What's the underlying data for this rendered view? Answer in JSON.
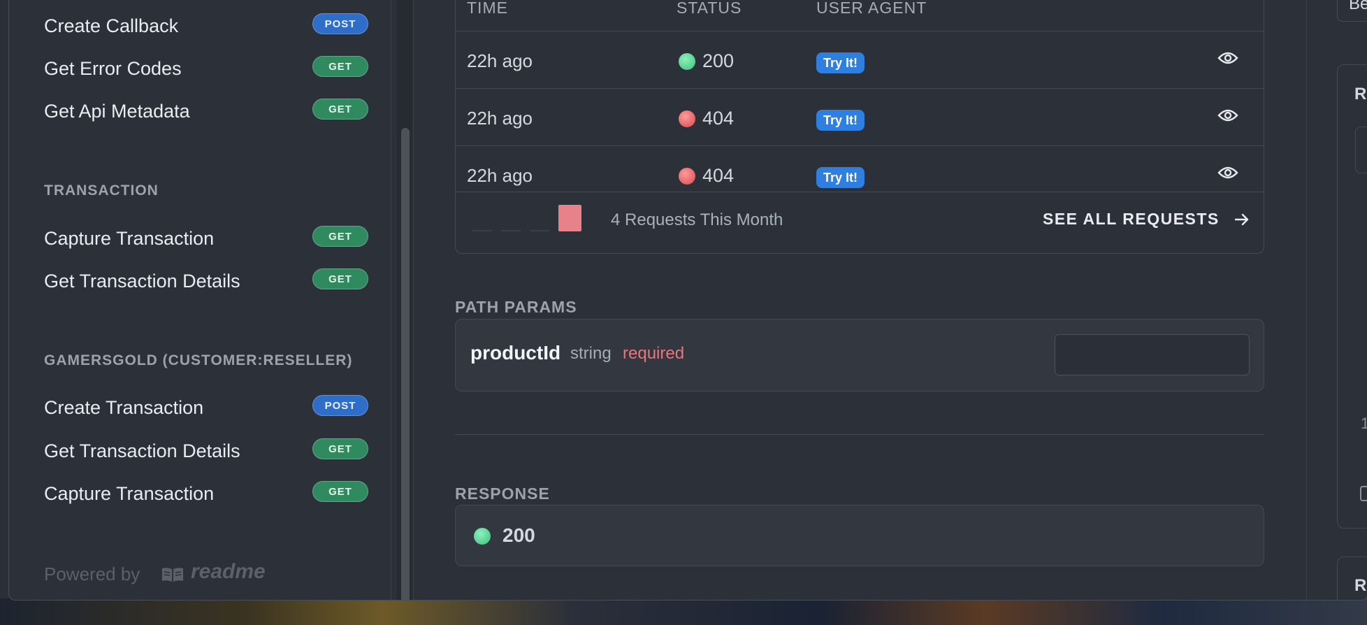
{
  "sidebar": {
    "items_top": [
      {
        "label": "Create Callback",
        "method": "POST"
      },
      {
        "label": "Get Error Codes",
        "method": "GET"
      },
      {
        "label": "Get Api Metadata",
        "method": "GET"
      }
    ],
    "sections": [
      {
        "title": "TRANSACTION",
        "items": [
          {
            "label": "Capture Transaction",
            "method": "GET"
          },
          {
            "label": "Get Transaction Details",
            "method": "GET"
          }
        ]
      },
      {
        "title": "GAMERSGOLD (CUSTOMER:RESELLER)",
        "items": [
          {
            "label": "Create Transaction",
            "method": "POST"
          },
          {
            "label": "Get Transaction Details",
            "method": "GET"
          },
          {
            "label": "Capture Transaction",
            "method": "GET"
          }
        ]
      }
    ],
    "powered_by": "Powered by",
    "brand": "readme"
  },
  "requests": {
    "columns": [
      "TIME",
      "STATUS",
      "USER AGENT"
    ],
    "rows": [
      {
        "time": "22h ago",
        "status": "200",
        "status_kind": "ok",
        "agent": "Try It!"
      },
      {
        "time": "22h ago",
        "status": "404",
        "status_kind": "error",
        "agent": "Try It!"
      },
      {
        "time": "22h ago",
        "status": "404",
        "status_kind": "error",
        "agent": "Try It!"
      }
    ],
    "summary": "4 Requests This Month",
    "see_all": "SEE ALL REQUESTS"
  },
  "path_params": {
    "heading": "PATH PARAMS",
    "param": {
      "name": "productId",
      "type": "string",
      "required": "required",
      "value": ""
    }
  },
  "response": {
    "heading": "RESPONSE",
    "code": "200"
  },
  "right_panel": {
    "top_text": "Be",
    "section_letter": "R",
    "number": "1",
    "bottom_letter": "R"
  },
  "colors": {
    "post_badge": "#2e6ec9",
    "get_badge": "#2f8a5f",
    "status_ok": "#3bbf7d",
    "status_error": "#d9474c",
    "try_it": "#2f7fe0",
    "required": "#e8767b"
  }
}
